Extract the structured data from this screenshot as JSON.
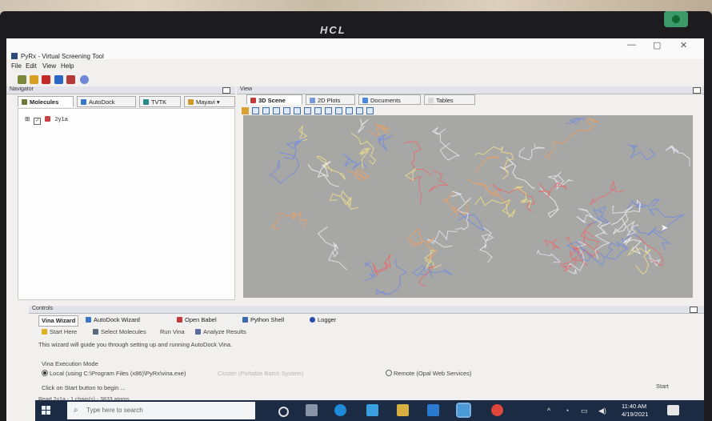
{
  "monitor": {
    "brand": "HCL"
  },
  "window": {
    "title": "PyRx - Virtual Screening Tool",
    "controls": {
      "minimize": "—",
      "maximize": "▢",
      "close": "✕"
    }
  },
  "menu": [
    "File",
    "Edit",
    "View",
    "Help"
  ],
  "navigator": {
    "header": "Navigator",
    "tabs": [
      "Molecules",
      "AutoDock",
      "TVTK",
      "Mayavi"
    ],
    "tree": [
      {
        "label": "2y1a",
        "checked": true
      }
    ]
  },
  "view": {
    "header": "View",
    "tabs": [
      "3D Scene",
      "2D Plots",
      "Documents",
      "Tables"
    ],
    "toolbar_icons": [
      "select-arrow-icon",
      "view-x-icon",
      "view-x-icon",
      "view-y-icon",
      "view-y-icon",
      "view-z-icon",
      "view-z-icon",
      "iso-icon",
      "color-icon",
      "axis-icon",
      "fit-icon",
      "save-icon",
      "reset-icon"
    ]
  },
  "controls": {
    "header": "Controls",
    "tabs": [
      "Vina Wizard",
      "AutoDock Wizard",
      "Open Babel",
      "Python Shell",
      "Logger"
    ],
    "steps": [
      "Start Here",
      "Select Molecules",
      "Run Vina",
      "Analyze Results"
    ],
    "intro": "This wizard will guide you through setting up and running AutoDock Vina.",
    "execution_mode_label": "Vina Execution Mode",
    "local_option": "Local (using C:\\Program Files (x86)\\PyRx\\vina.exe)",
    "cluster_option": "Cluster (Portable Batch System)",
    "remote_option": "Remote (Opal Web Services)",
    "prompt": "Click on Start button to begin ...",
    "start_label": "Start"
  },
  "status_bar": "Read 2y1a - 1 chain(s) - 3833 atoms",
  "taskbar": {
    "search_placeholder": "Type here to search",
    "time": "11:40 AM",
    "date": "4/19/2021"
  },
  "colors": {
    "scene_bg": "#a7a7a5",
    "taskbar_bg": "#1b2b44",
    "accent": "#2f62b3",
    "molecule_colors": [
      "#f2f2f2",
      "#e7e7f3",
      "#6f8be0",
      "#e86a6a",
      "#efe08a",
      "#f0a060"
    ]
  }
}
